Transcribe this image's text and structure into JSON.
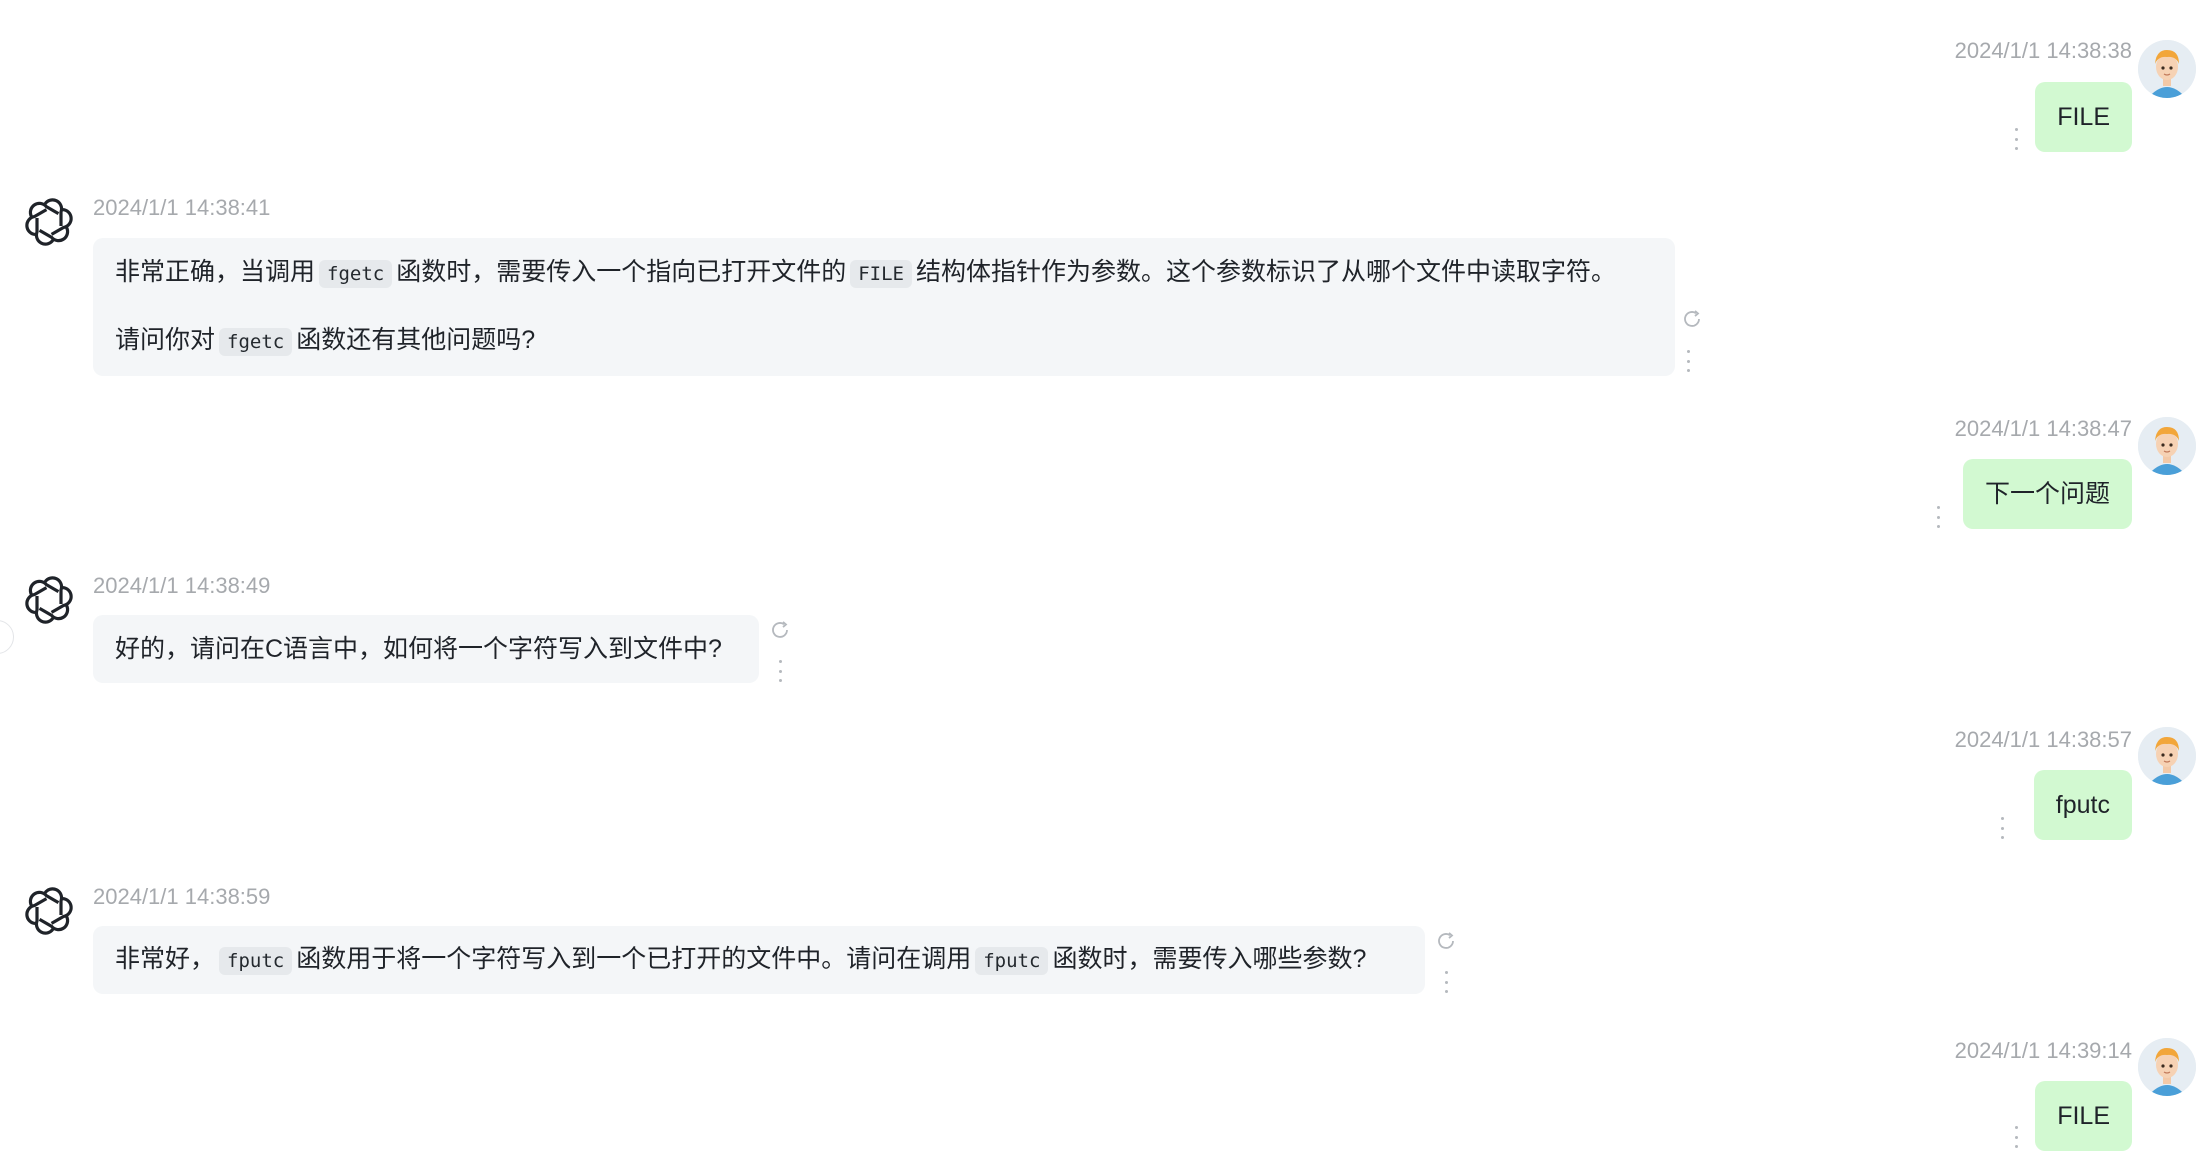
{
  "messages": [
    {
      "role": "user",
      "time": "2024/1/1 14:38:38",
      "text": "FILE"
    },
    {
      "role": "bot",
      "time": "2024/1/1 14:38:41",
      "p1_a": "非常正确，当调用",
      "p1_code1": "fgetc",
      "p1_b": "函数时，需要传入一个指向已打开文件的",
      "p1_code2": "FILE",
      "p1_c": "结构体指针作为参数。这个参数标识了从哪个文件中读取字符。",
      "p2_a": "请问你对",
      "p2_code1": "fgetc",
      "p2_b": "函数还有其他问题吗?"
    },
    {
      "role": "user",
      "time": "2024/1/1 14:38:47",
      "text": "下一个问题"
    },
    {
      "role": "bot",
      "time": "2024/1/1 14:38:49",
      "text": "好的，请问在C语言中，如何将一个字符写入到文件中?"
    },
    {
      "role": "user",
      "time": "2024/1/1 14:38:57",
      "text": "fputc"
    },
    {
      "role": "bot",
      "time": "2024/1/1 14:38:59",
      "p1_a": "非常好，",
      "p1_code1": "fputc",
      "p1_b": "函数用于将一个字符写入到一个已打开的文件中。请问在调用",
      "p1_code2": "fputc",
      "p1_c": "函数时，需要传入哪些参数?"
    },
    {
      "role": "user",
      "time": "2024/1/1 14:39:14",
      "text": "FILE"
    }
  ],
  "icons": {
    "bot_avatar": "openai-logo-icon",
    "user_avatar": "user-avatar",
    "more": "more-vertical-icon",
    "regenerate": "refresh-icon"
  },
  "colors": {
    "user_bubble": "#d2f9d1",
    "bot_bubble": "#f4f6f8",
    "timestamp": "#a6a9ad"
  }
}
